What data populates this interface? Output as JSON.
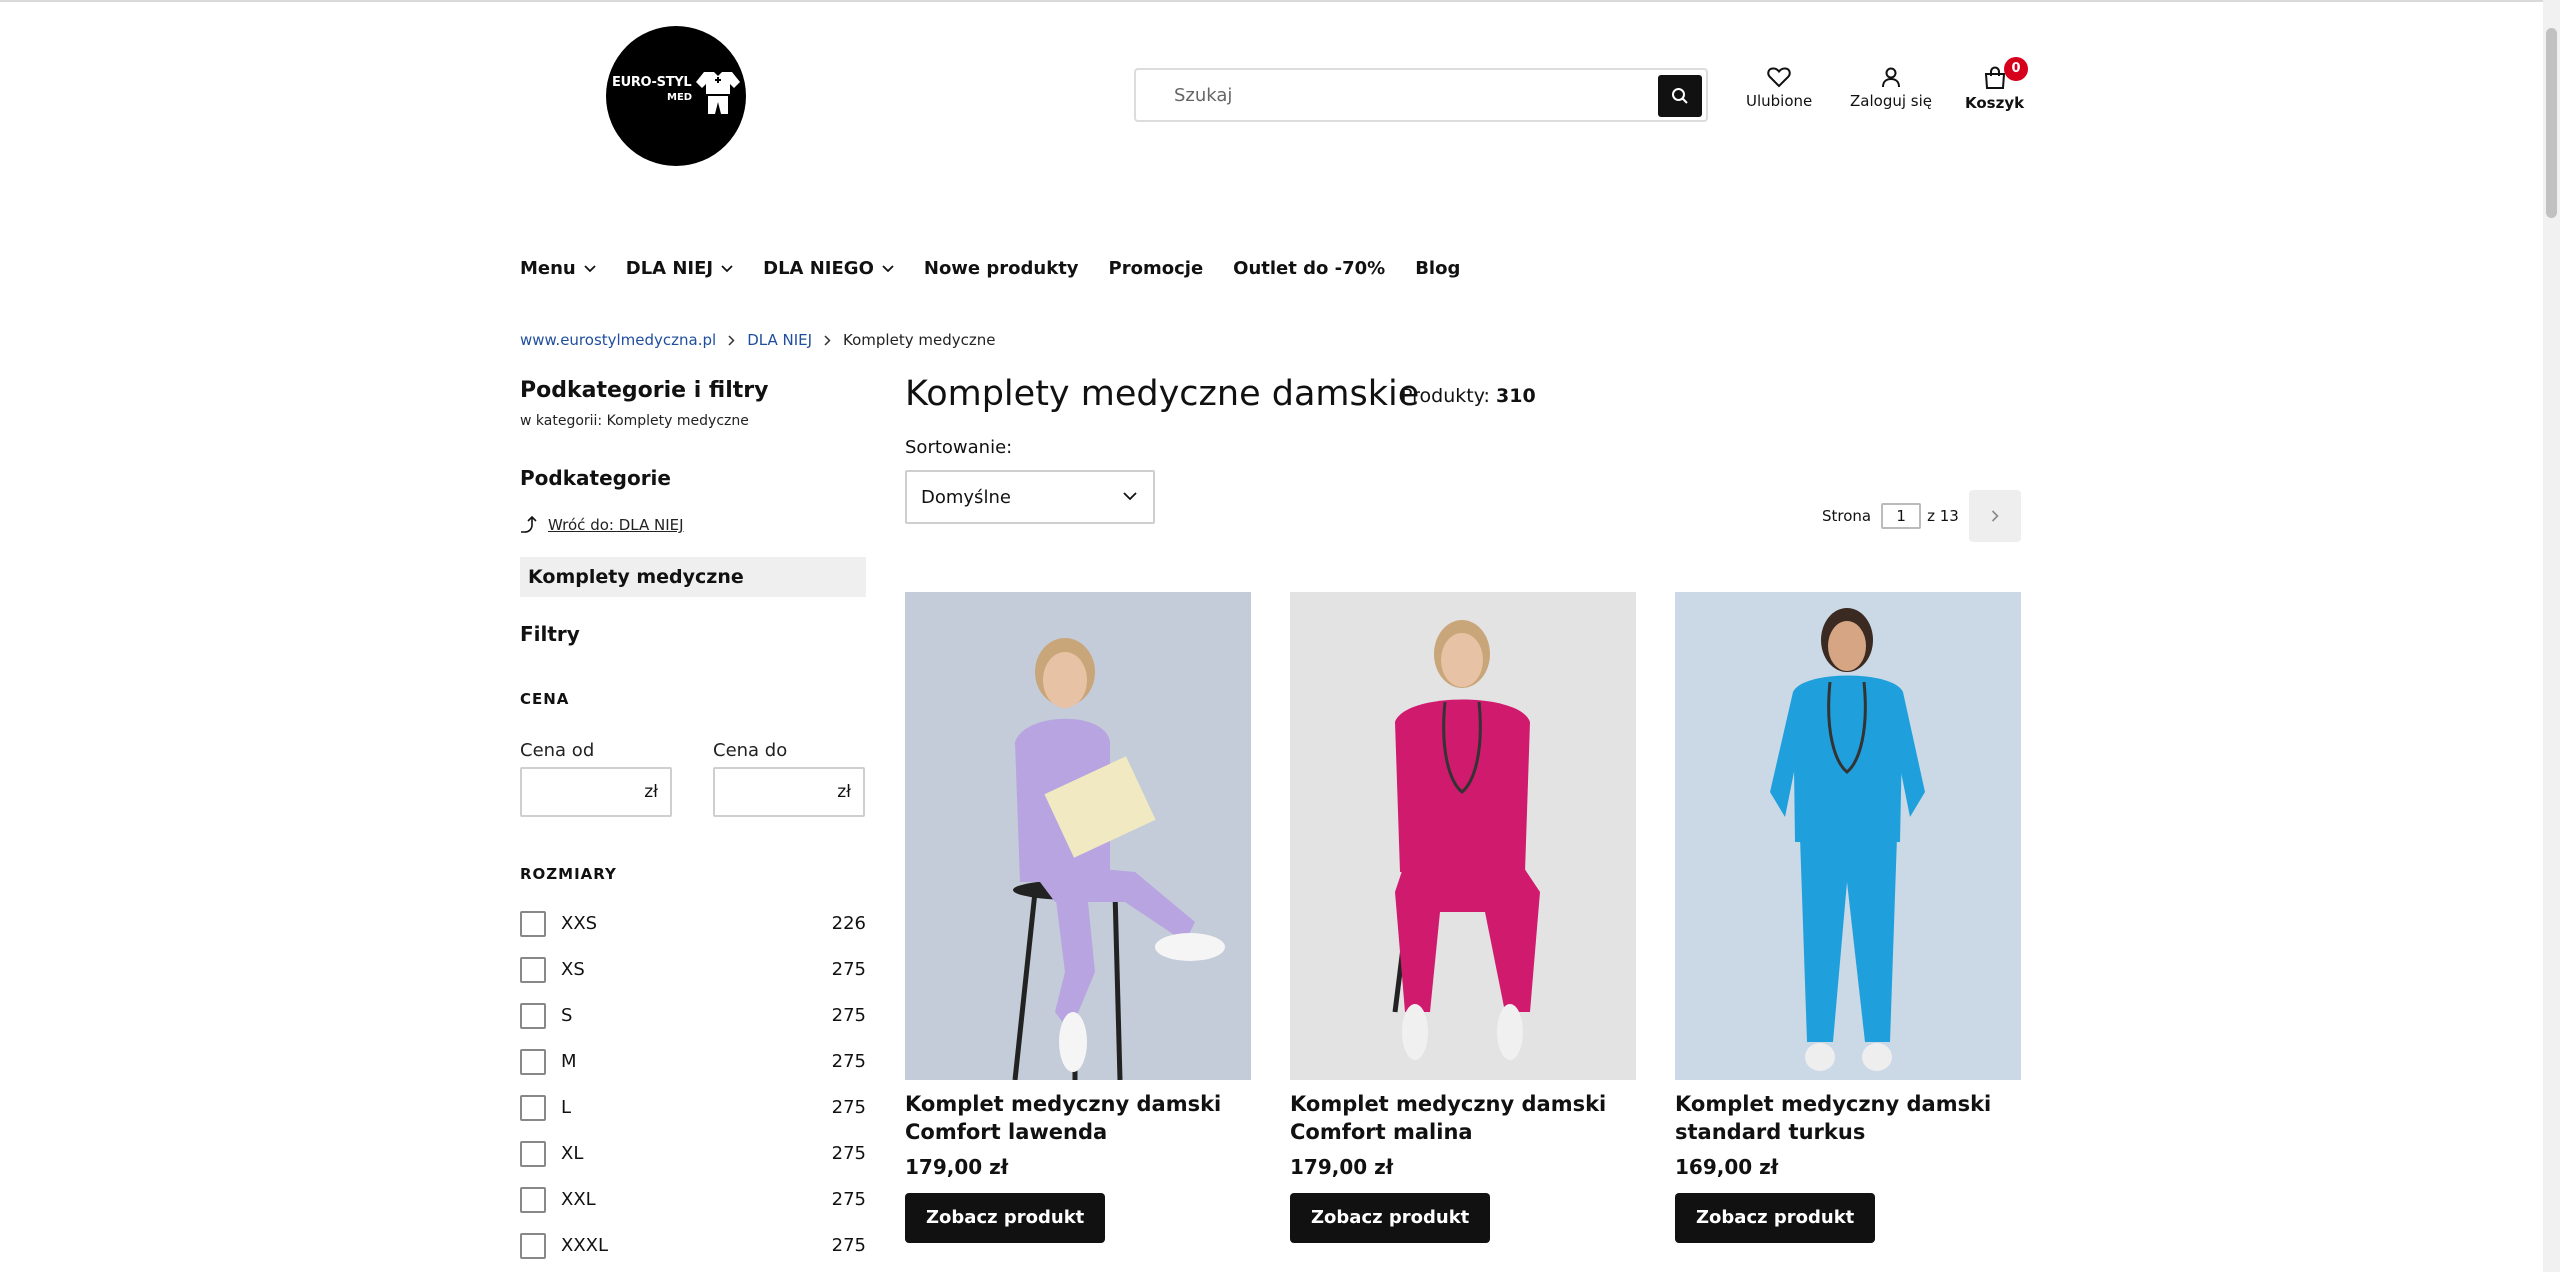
{
  "logo": {
    "line1": "EURO-STYL",
    "line2": "MED"
  },
  "search": {
    "placeholder": "Szukaj"
  },
  "header": {
    "favorites_label": "Ulubione",
    "login_label": "Zaloguj się",
    "cart_label": "Koszyk",
    "cart_count": "0"
  },
  "nav": {
    "items": [
      {
        "label": "Menu",
        "dropdown": true
      },
      {
        "label": "DLA NIEJ",
        "dropdown": true
      },
      {
        "label": "DLA NIEGO",
        "dropdown": true
      },
      {
        "label": "Nowe produkty",
        "dropdown": false
      },
      {
        "label": "Promocje",
        "dropdown": false
      },
      {
        "label": "Outlet do -70%",
        "dropdown": false
      },
      {
        "label": "Blog",
        "dropdown": false
      }
    ]
  },
  "breadcrumb": {
    "home": "www.eurostylmedyczna.pl",
    "parent": "DLA NIEJ",
    "current": "Komplety medyczne"
  },
  "sidebar": {
    "title": "Podkategorie i filtry",
    "subtitle": "w kategorii: Komplety medyczne",
    "subcategories_heading": "Podkategorie",
    "back_link": "Wróć do: DLA NIEJ",
    "active_category": "Komplety medyczne",
    "filters_heading": "Filtry",
    "price_heading": "CENA",
    "price_from_label": "Cena od",
    "price_to_label": "Cena do",
    "currency": "zł",
    "sizes_heading": "ROZMIARY",
    "sizes": [
      {
        "label": "XXS",
        "count": "226"
      },
      {
        "label": "XS",
        "count": "275"
      },
      {
        "label": "S",
        "count": "275"
      },
      {
        "label": "M",
        "count": "275"
      },
      {
        "label": "L",
        "count": "275"
      },
      {
        "label": "XL",
        "count": "275"
      },
      {
        "label": "XXL",
        "count": "275"
      },
      {
        "label": "XXXL",
        "count": "275"
      }
    ]
  },
  "main": {
    "title": "Komplety medyczne damskie",
    "count_label": "Produkty:",
    "count_value": "310",
    "sort_label": "Sortowanie:",
    "sort_value": "Domyślne",
    "pager": {
      "page_label": "Strona",
      "current": "1",
      "of_label": "z 13"
    }
  },
  "products": [
    {
      "name": "Komplet medyczny damski Comfort lawenda",
      "price": "179,00 zł",
      "button": "Zobacz produkt",
      "uniform_color": "#b8a4e0",
      "background": "#c3ccd8"
    },
    {
      "name": "Komplet medyczny damski Comfort malina",
      "price": "179,00 zł",
      "button": "Zobacz produkt",
      "uniform_color": "#d01a6e",
      "background": "#e3e3e3"
    },
    {
      "name": "Komplet medyczny damski standard turkus",
      "price": "169,00 zł",
      "button": "Zobacz produkt",
      "uniform_color": "#1fa0dc",
      "background": "#cbd9e6"
    }
  ]
}
